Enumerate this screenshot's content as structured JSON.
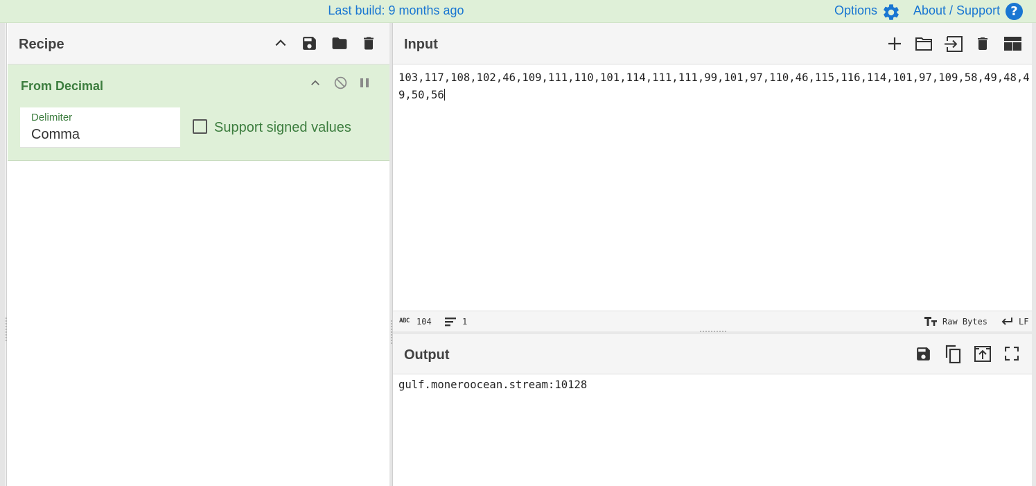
{
  "banner": {
    "build": "Last build: 9 months ago",
    "options_label": "Options",
    "about_label": "About / Support",
    "help_glyph": "?"
  },
  "recipe": {
    "title": "Recipe",
    "icons": [
      "chevron-up-icon",
      "save-icon",
      "folder-icon",
      "trash-icon"
    ],
    "operation": {
      "name": "From Decimal",
      "delimiter_label": "Delimiter",
      "delimiter_value": "Comma",
      "signed_label": "Support signed values",
      "signed_checked": false
    }
  },
  "input": {
    "title": "Input",
    "text": "103,117,108,102,46,109,111,110,101,114,111,111,99,101,97,110,46,115,116,114,101,97,109,58,49,48,49,50,56",
    "status": {
      "length": "104",
      "lines": "1",
      "encoding": "Raw Bytes",
      "eol": "LF"
    }
  },
  "output": {
    "title": "Output",
    "text": "gulf.moneroocean.stream:10128"
  },
  "colors": {
    "banner_bg": "#dff0d8",
    "link": "#1976d2",
    "operation_bg": "#dff0d8",
    "operation_text": "#3c7d3e"
  }
}
